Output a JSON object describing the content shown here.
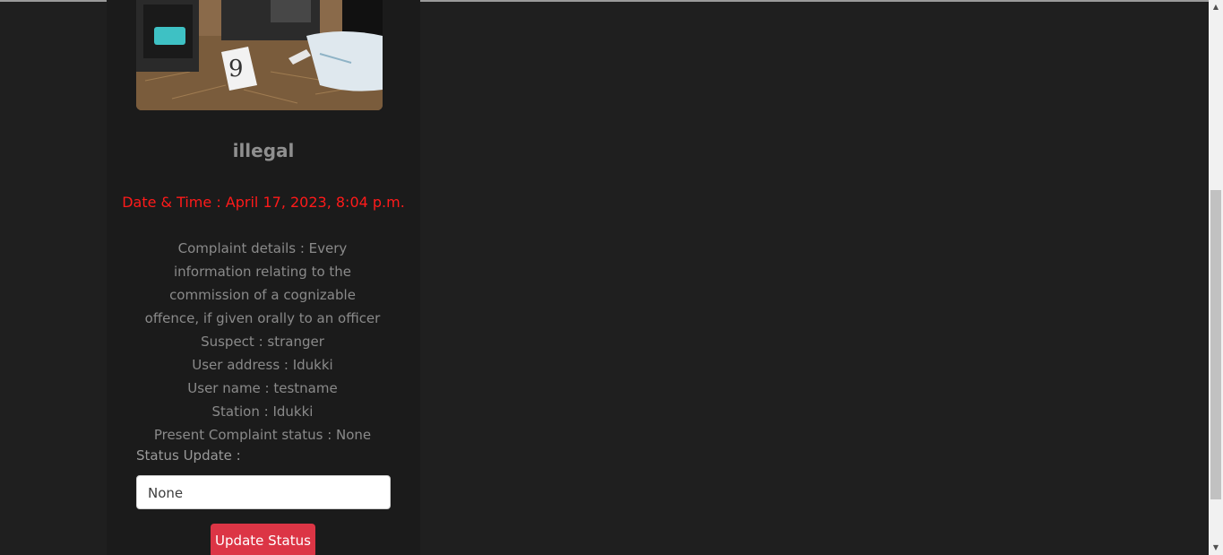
{
  "complaint": {
    "title": "illegal",
    "datetime": "Date & Time : April 17, 2023, 8:04 p.m.",
    "details_text": "Complaint details : Every information relating to the commission of a cognizable offence, if given orally to an officer",
    "suspect": "Suspect : stranger",
    "user_address": "User address : Idukki",
    "user_name": "User name : testname",
    "station": "Station : Idukki",
    "present_status": "Present Complaint status : None"
  },
  "status_form": {
    "label": "Status Update :",
    "selected_value": "None",
    "button_label": "Update Status"
  },
  "scrollbar": {
    "up_arrow": "▲",
    "down_arrow": "▼"
  },
  "colors": {
    "accent": "#dc3545",
    "datetime": "#ff1a1a",
    "background": "#1f1f1f"
  }
}
